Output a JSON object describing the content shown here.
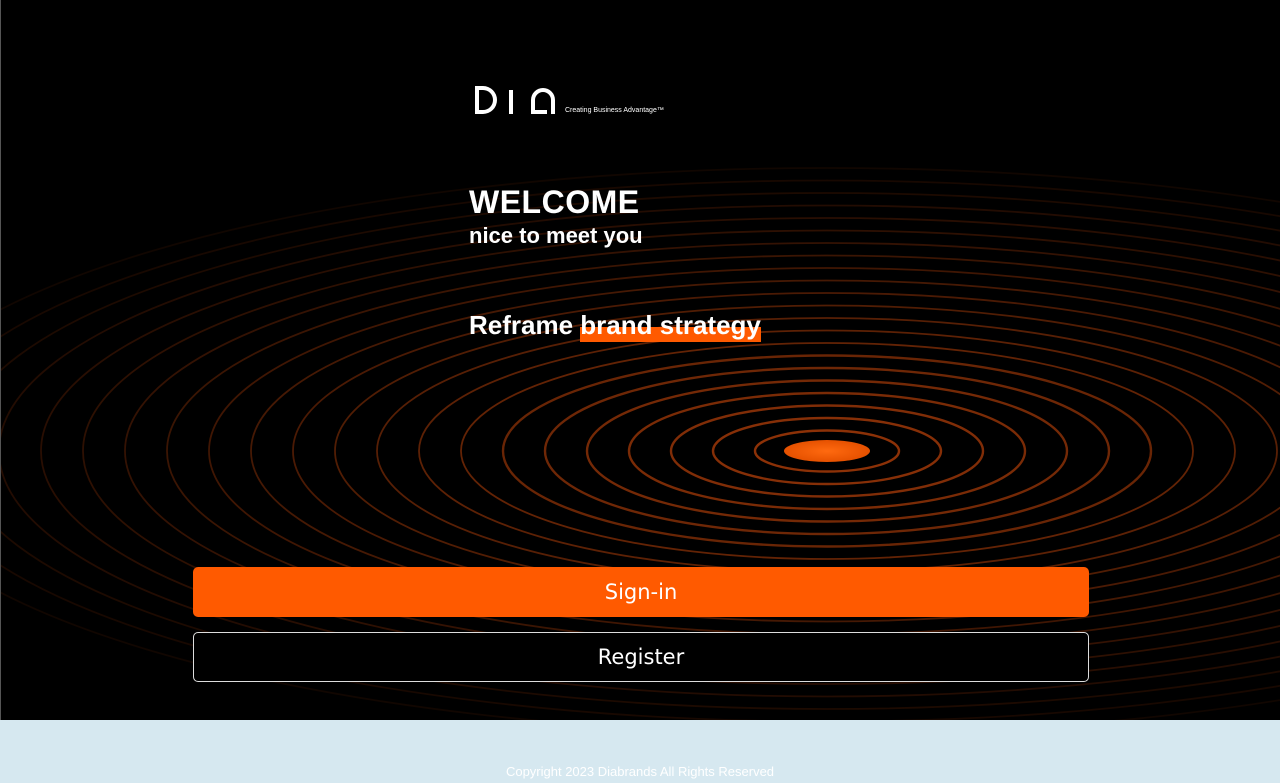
{
  "brand": {
    "logo_text": "DIA",
    "tagline": "Creating Business Advantage™"
  },
  "hero": {
    "title": "WELCOME",
    "subtitle": "nice to meet you",
    "statement_plain": "Reframe ",
    "statement_highlight": "brand strategy"
  },
  "actions": {
    "signin_label": "Sign-in",
    "register_label": "Register"
  },
  "footer": {
    "copyright": "Copyright 2023 Diabrands All Rights Reserved"
  },
  "colors": {
    "accent": "#ff5a00",
    "hero_bg": "#000000",
    "page_bg": "#d6e8f0"
  }
}
